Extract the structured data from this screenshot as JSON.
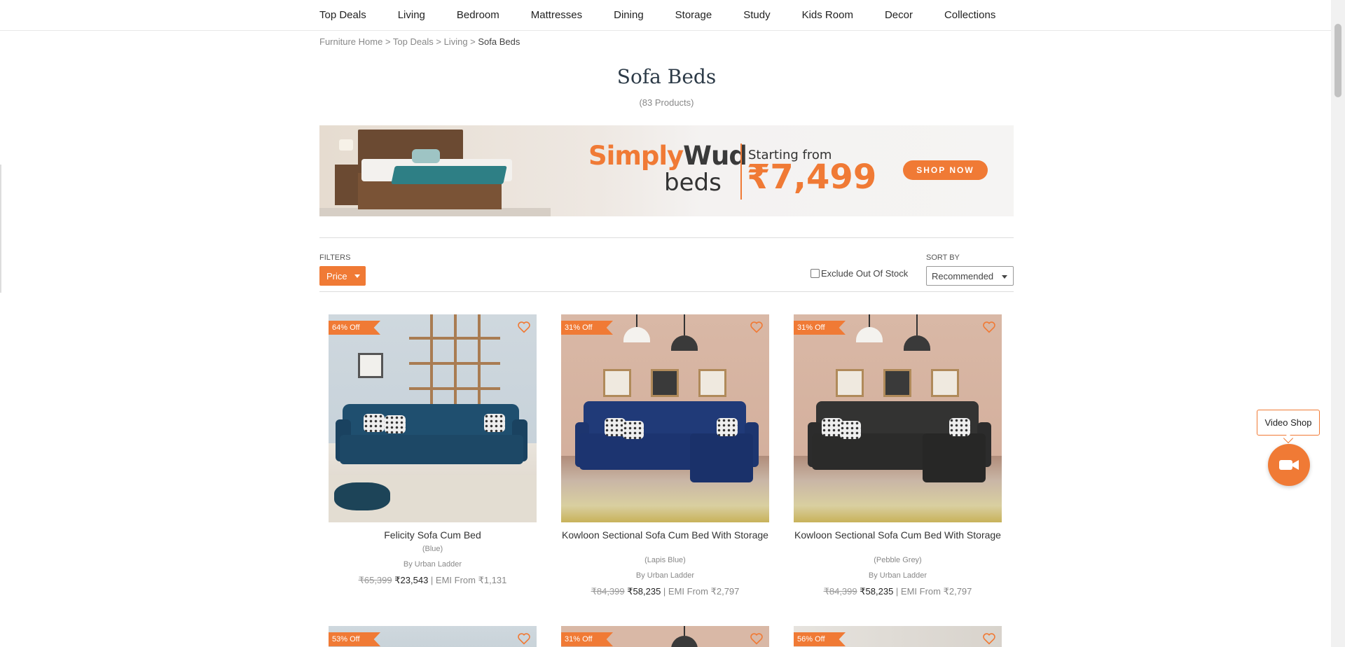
{
  "nav": {
    "items": [
      "Top Deals",
      "Living",
      "Bedroom",
      "Mattresses",
      "Dining",
      "Storage",
      "Study",
      "Kids Room",
      "Decor",
      "Collections"
    ]
  },
  "breadcrumb": {
    "items": [
      "Furniture Home",
      "Top Deals",
      "Living"
    ],
    "separator": ">",
    "current": "Sofa Beds"
  },
  "page": {
    "title": "Sofa Beds",
    "count": "(83 Products)"
  },
  "banner": {
    "brand_part1": "Simply",
    "brand_part2": "Wud",
    "brand_sub": "beds",
    "starting_from": "Starting from",
    "price": "₹7,499",
    "cta": "SHOP NOW"
  },
  "filters": {
    "label": "FILTERS",
    "price_button": "Price",
    "exclude_label": "Exclude Out Of Stock",
    "exclude_checked": false,
    "sort_label": "SORT BY",
    "sort_value": "Recommended"
  },
  "products": [
    {
      "badge": "64% Off",
      "name": "Felicity Sofa Cum Bed",
      "color": "(Blue)",
      "by": "By Urban Ladder",
      "mrp": "₹65,399",
      "price": "₹23,543",
      "sep": " | ",
      "emi": "EMI From ₹1,131"
    },
    {
      "badge": "31% Off",
      "name": "Kowloon Sectional Sofa Cum Bed With Storage",
      "color": "(Lapis Blue)",
      "by": "By Urban Ladder",
      "mrp": "₹84,399",
      "price": "₹58,235",
      "sep": " | ",
      "emi": "EMI From ₹2,797"
    },
    {
      "badge": "31% Off",
      "name": "Kowloon Sectional Sofa Cum Bed With Storage",
      "color": "(Pebble Grey)",
      "by": "By Urban Ladder",
      "mrp": "₹84,399",
      "price": "₹58,235",
      "sep": " | ",
      "emi": "EMI From ₹2,797"
    }
  ],
  "next_row_badges": [
    "53% Off",
    "31% Off",
    "56% Off"
  ],
  "video": {
    "label": "Video Shop"
  },
  "colors": {
    "accent": "#f07a35",
    "title": "#2c3a47"
  }
}
